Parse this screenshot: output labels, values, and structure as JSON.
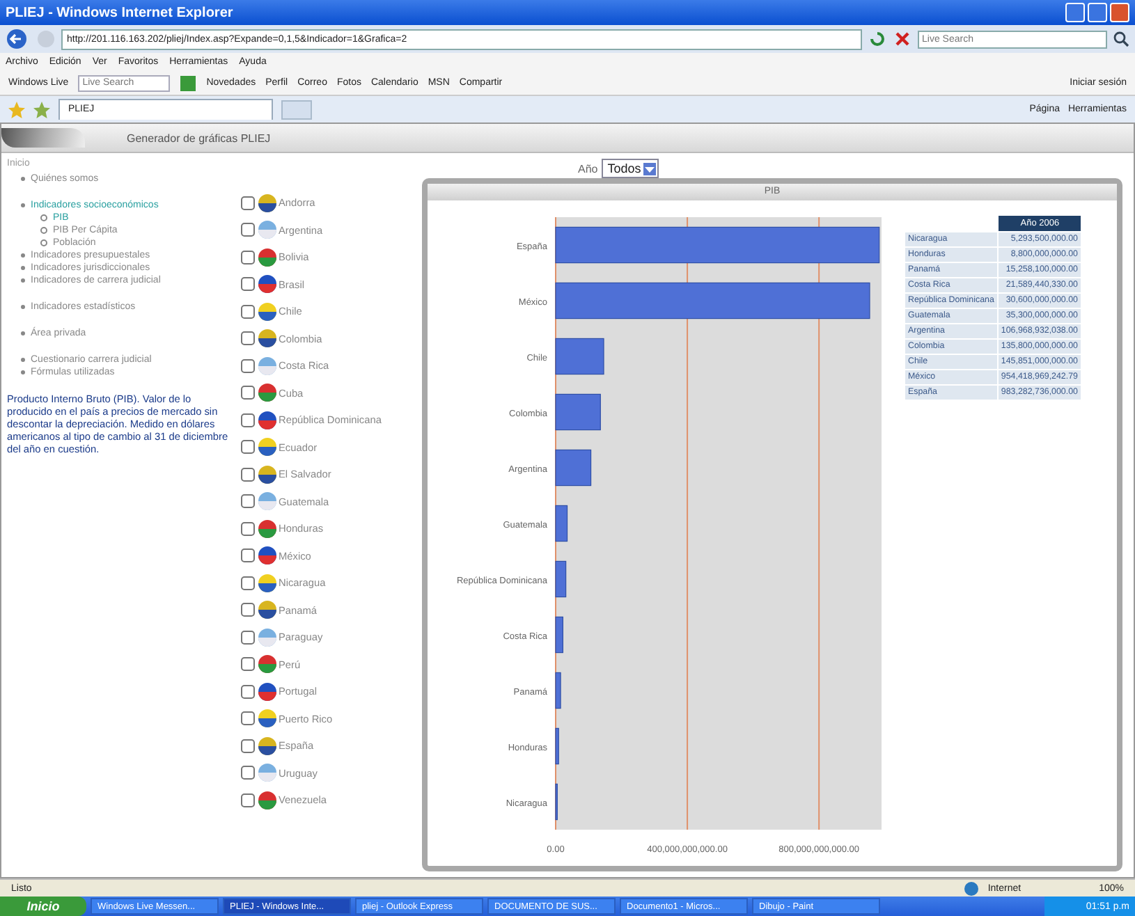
{
  "window": {
    "title": "PLIEJ - Windows Internet Explorer"
  },
  "address_bar": {
    "url": "http://201.116.163.202/pliej/Index.asp?Expande=0,1,5&Indicador=1&Grafica=2",
    "search_placeholder": "Live Search"
  },
  "menu": [
    "Archivo",
    "Edición",
    "Ver",
    "Favoritos",
    "Herramientas",
    "Ayuda"
  ],
  "links_bar": {
    "brand": "Windows Live",
    "search_placeholder": "Live Search",
    "links": [
      "Novedades",
      "Perfil",
      "Correo",
      "Fotos",
      "Calendario",
      "MSN",
      "Compartir"
    ],
    "sign_in": "Iniciar sesión"
  },
  "tabs": [
    {
      "label": "PLIEJ",
      "selected": true
    }
  ],
  "command_bar": [
    "Página",
    "Herramientas"
  ],
  "page": {
    "header": "Generador de gráficas PLIEJ",
    "home": "Inicio",
    "nav_groups": [
      [
        {
          "label": "Quiénes somos",
          "selected": false
        }
      ],
      [
        {
          "label": "Indicadores socioeconómicos",
          "selected": true,
          "children": [
            {
              "label": "PIB",
              "selected": true
            },
            {
              "label": "PIB Per Cápita",
              "selected": false
            },
            {
              "label": "Población",
              "selected": false
            }
          ]
        },
        {
          "label": "Indicadores presupuestales",
          "selected": false
        },
        {
          "label": "Indicadores jurisdiccionales",
          "selected": false
        },
        {
          "label": "Indicadores de carrera judicial",
          "selected": false
        }
      ],
      [
        {
          "label": "Indicadores estadísticos",
          "selected": false
        }
      ],
      [
        {
          "label": "Área privada",
          "selected": false
        }
      ],
      [
        {
          "label": "Cuestionario carrera judicial",
          "selected": false
        },
        {
          "label": "Fórmulas utilizadas",
          "selected": false
        }
      ]
    ],
    "description": "Producto Interno Bruto (PIB). Valor de lo producido en el país a precios de mercado sin descontar la depreciación. Medido en dólares americanos al tipo de cambio al 31 de diciembre del año en cuestión.",
    "countries": [
      {
        "name": "Andorra",
        "checked": false
      },
      {
        "name": "Argentina",
        "checked": false
      },
      {
        "name": "Bolivia",
        "checked": false
      },
      {
        "name": "Brasil",
        "checked": false
      },
      {
        "name": "Chile",
        "checked": false
      },
      {
        "name": "Colombia",
        "checked": false
      },
      {
        "name": "Costa Rica",
        "checked": false
      },
      {
        "name": "Cuba",
        "checked": false
      },
      {
        "name": "República Dominicana",
        "checked": false
      },
      {
        "name": "Ecuador",
        "checked": false
      },
      {
        "name": "El Salvador",
        "checked": false
      },
      {
        "name": "Guatemala",
        "checked": false
      },
      {
        "name": "Honduras",
        "checked": false
      },
      {
        "name": "México",
        "checked": false
      },
      {
        "name": "Nicaragua",
        "checked": false
      },
      {
        "name": "Panamá",
        "checked": false
      },
      {
        "name": "Paraguay",
        "checked": false
      },
      {
        "name": "Perú",
        "checked": false
      },
      {
        "name": "Portugal",
        "checked": false
      },
      {
        "name": "Puerto Rico",
        "checked": false
      },
      {
        "name": "España",
        "checked": false
      },
      {
        "name": "Uruguay",
        "checked": false
      },
      {
        "name": "Venezuela",
        "checked": false
      }
    ],
    "year_filter": {
      "label": "Año",
      "value": "Todos"
    },
    "panel": {
      "title": "PIB",
      "chart_data": {
        "type": "bar",
        "orientation": "horizontal",
        "categories": [
          "España",
          "México",
          "Chile",
          "Colombia",
          "Argentina",
          "Guatemala",
          "República Dominicana",
          "Costa Rica",
          "Panamá",
          "Honduras",
          "Nicaragua"
        ],
        "values": [
          983000000000,
          954000000000,
          146000000000,
          136000000000,
          107000000000,
          35000000000,
          31000000000,
          22000000000,
          15000000000,
          9000000000,
          5000000000
        ],
        "xlim": [
          0,
          990000000000
        ],
        "xticks": [
          {
            "value": 0,
            "label": "0.00"
          },
          {
            "value": 400000000000,
            "label": "400,000,000,000.00"
          },
          {
            "value": 800000000000,
            "label": "800,000,000,000.00"
          }
        ]
      },
      "table": {
        "header": "Año 2006",
        "rows": [
          {
            "country": "Nicaragua",
            "value": "5,293,500,000.00"
          },
          {
            "country": "Honduras",
            "value": "8,800,000,000.00"
          },
          {
            "country": "Panamá",
            "value": "15,258,100,000.00"
          },
          {
            "country": "Costa Rica",
            "value": "21,589,440,330.00"
          },
          {
            "country": "República Dominicana",
            "value": "30,600,000,000.00"
          },
          {
            "country": "Guatemala",
            "value": "35,300,000,000.00"
          },
          {
            "country": "Argentina",
            "value": "106,968,932,038.00"
          },
          {
            "country": "Colombia",
            "value": "135,800,000,000.00"
          },
          {
            "country": "Chile",
            "value": "145,851,000,000.00"
          },
          {
            "country": "México",
            "value": "954,418,969,242.79"
          },
          {
            "country": "España",
            "value": "983,282,736,000.00"
          }
        ]
      }
    }
  },
  "status_bar": {
    "text": "Listo",
    "zone": "Internet",
    "zoom": "100%"
  },
  "taskbar": {
    "start": "Inicio",
    "items": [
      {
        "label": "Windows Live Messen...",
        "selected": false
      },
      {
        "label": "PLIEJ - Windows Inte...",
        "selected": true
      },
      {
        "label": "pliej - Outlook Express",
        "selected": false
      },
      {
        "label": "DOCUMENTO DE SUS...",
        "selected": false
      },
      {
        "label": "Documento1 - Micros...",
        "selected": false
      },
      {
        "label": "Dibujo - Paint",
        "selected": false
      }
    ],
    "clock": "01:51 p.m"
  }
}
